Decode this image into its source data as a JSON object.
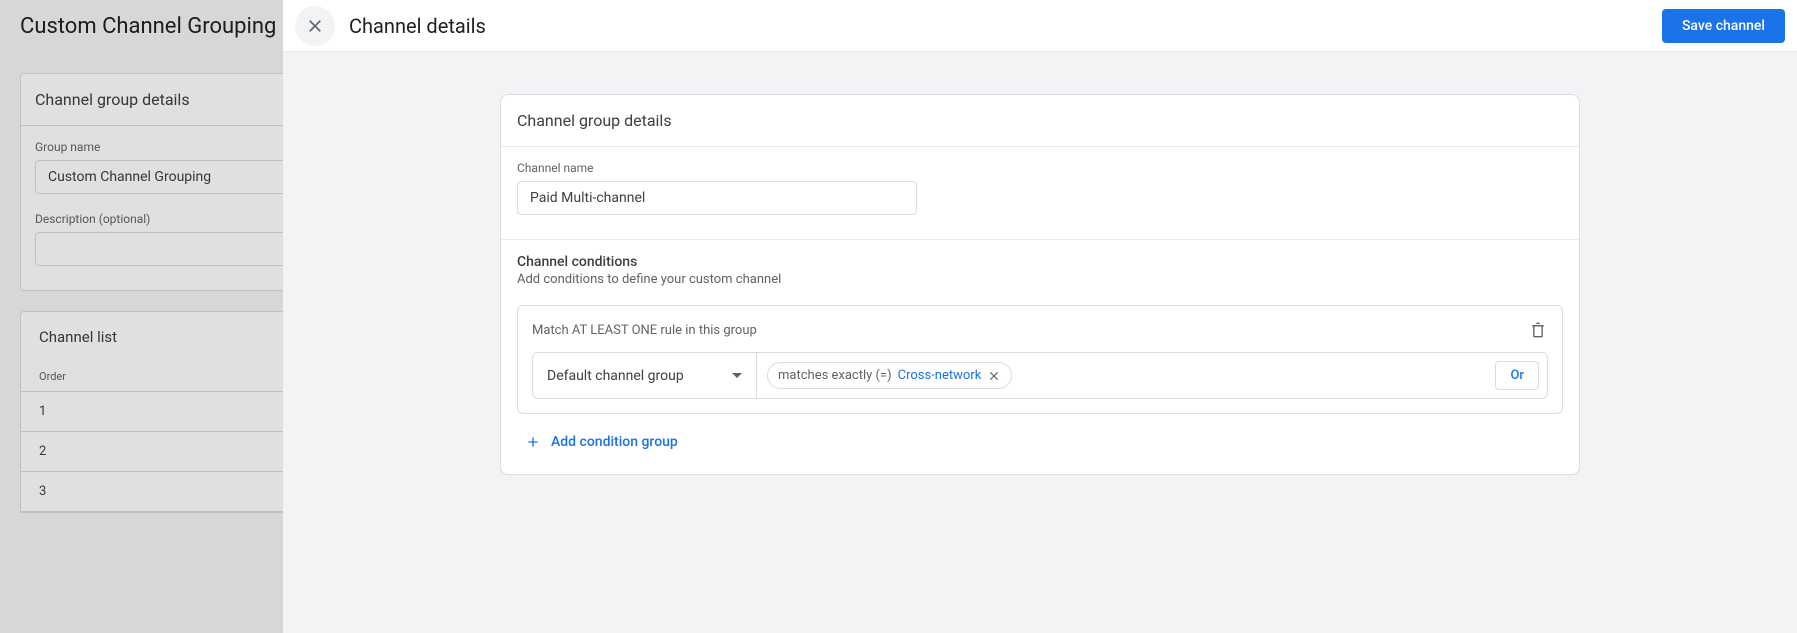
{
  "background": {
    "page_title": "Custom Channel Grouping",
    "group_details_header": "Channel group details",
    "group_name_label": "Group name",
    "group_name_value": "Custom Channel Grouping",
    "description_label": "Description (optional)",
    "description_value": "",
    "channel_list_header": "Channel list",
    "order_header": "Order",
    "rows": [
      "1",
      "2",
      "3"
    ]
  },
  "modal": {
    "title": "Channel details",
    "save_label": "Save channel",
    "card_header": "Channel group details",
    "channel_name_label": "Channel name",
    "channel_name_value": "Paid Multi-channel",
    "conditions_title": "Channel conditions",
    "conditions_sub": "Add conditions to define your custom channel",
    "rule_group_label": "Match AT LEAST ONE rule in this group",
    "rule_select": "Default channel group",
    "chip_operator": "matches exactly (=)",
    "chip_value": "Cross-network",
    "or_label": "Or",
    "add_group_label": "Add condition group"
  }
}
